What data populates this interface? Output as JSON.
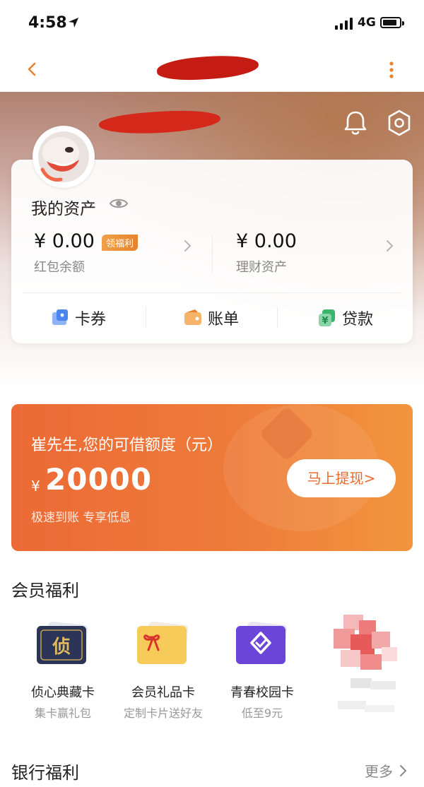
{
  "status_bar": {
    "time": "4:58",
    "network": "4G"
  },
  "nav": {
    "title": ""
  },
  "header": {
    "user_name": ""
  },
  "assets": {
    "title": "我的资产",
    "red_packet_amount": "¥ 0.00",
    "red_packet_label": "红包余额",
    "red_packet_badge": "领福利",
    "wealth_amount": "¥ 0.00",
    "wealth_label": "理财资产",
    "shortcuts": [
      {
        "label": "卡券",
        "icon": "coupon-icon"
      },
      {
        "label": "账单",
        "icon": "wallet-icon"
      },
      {
        "label": "贷款",
        "icon": "loan-icon"
      }
    ]
  },
  "loan": {
    "title": "崔先生,您的可借额度（元）",
    "currency": "¥",
    "amount": "20000",
    "subtitle": "极速到账 专享低息",
    "button": "马上提现>"
  },
  "member": {
    "title": "会员福利",
    "items": [
      {
        "title": "侦心典藏卡",
        "subtitle": "集卡赢礼包",
        "icon": "collector-card-icon"
      },
      {
        "title": "会员礼品卡",
        "subtitle": "定制卡片送好友",
        "icon": "gift-card-icon"
      },
      {
        "title": "青春校园卡",
        "subtitle": "低至9元",
        "icon": "campus-card-icon"
      }
    ]
  },
  "bank": {
    "title": "银行福利",
    "more": "更多"
  },
  "colors": {
    "accent": "#e8692e",
    "banner": "#ee7b3a",
    "redaction": "#c41c12"
  }
}
